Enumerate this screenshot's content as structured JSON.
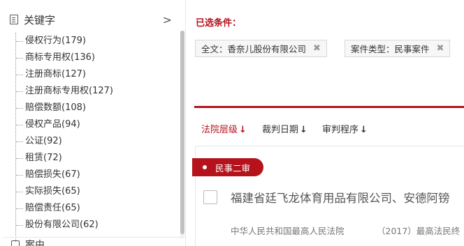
{
  "sidebar": {
    "header": {
      "title": "关键字",
      "icon": "document-icon"
    },
    "items": [
      "侵权行为(179)",
      "商标专用权(136)",
      "注册商标(127)",
      "注册商标专用权(127)",
      "赔偿数额(108)",
      "侵权产品(94)",
      "公证(92)",
      "租赁(72)",
      "赔偿损失(67)",
      "实际损失(65)",
      "赔偿责任(65)",
      "股份有限公司(62)"
    ],
    "next_header": {
      "title": "案由",
      "icon": "list-icon"
    }
  },
  "conditions": {
    "title": "已选条件：",
    "tags": [
      {
        "label": "全文：香奈儿股份有限公司",
        "close": "✖"
      },
      {
        "label": "案件类型：民事案件",
        "close": "✖"
      }
    ]
  },
  "sort": {
    "items": [
      {
        "label": "法院层级",
        "arrow": "↓",
        "active": true
      },
      {
        "label": "裁判日期",
        "arrow": "↓",
        "active": false
      },
      {
        "label": "审判程序",
        "arrow": "↓",
        "active": false
      }
    ]
  },
  "result": {
    "badge": "民事二审",
    "title": "福建省廷飞龙体育用品有限公司、安德阿镑",
    "court": "中华人民共和国最高人民法院",
    "case_no": "（2017）最高法民终"
  },
  "colors": {
    "accent": "#b5121b"
  }
}
